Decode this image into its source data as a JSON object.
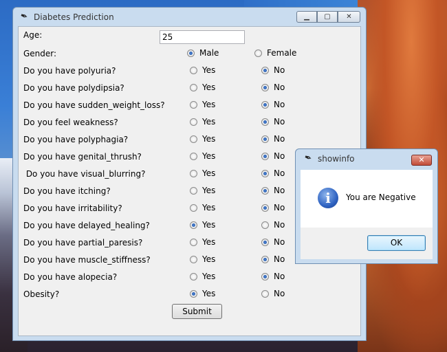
{
  "main_window": {
    "title": "Diabetes Prediction",
    "age": {
      "label": "Age:",
      "value": "25"
    },
    "gender": {
      "label": "Gender:",
      "options": [
        "Male",
        "Female"
      ],
      "selected": "Male"
    },
    "questions": [
      {
        "label": "Do you have polyuria?",
        "yes": "Yes",
        "no": "No",
        "selected": "No"
      },
      {
        "label": "Do you have polydipsia?",
        "yes": "Yes",
        "no": "No",
        "selected": "No"
      },
      {
        "label": "Do you have sudden_weight_loss?",
        "yes": "Yes",
        "no": "No",
        "selected": "No"
      },
      {
        "label": "Do you feel weakness?",
        "yes": "Yes",
        "no": "No",
        "selected": "No"
      },
      {
        "label": "Do you have polyphagia?",
        "yes": "Yes",
        "no": "No",
        "selected": "No"
      },
      {
        "label": "Do you have genital_thrush?",
        "yes": "Yes",
        "no": "No",
        "selected": "No"
      },
      {
        "label": " Do you have visual_blurring?",
        "yes": "Yes",
        "no": "No",
        "selected": "No"
      },
      {
        "label": "Do you have itching?",
        "yes": "Yes",
        "no": "No",
        "selected": "No"
      },
      {
        "label": "Do you have irritability?",
        "yes": "Yes",
        "no": "No",
        "selected": "No"
      },
      {
        "label": "Do you have delayed_healing?",
        "yes": "Yes",
        "no": "No",
        "selected": "Yes"
      },
      {
        "label": "Do you have partial_paresis?",
        "yes": "Yes",
        "no": "No",
        "selected": "No"
      },
      {
        "label": "Do you have muscle_stiffness?",
        "yes": "Yes",
        "no": "No",
        "selected": "No"
      },
      {
        "label": "Do you have alopecia?",
        "yes": "Yes",
        "no": "No",
        "selected": "No"
      },
      {
        "label": "Obesity?",
        "yes": "Yes",
        "no": "No",
        "selected": "Yes"
      }
    ],
    "submit_label": "Submit"
  },
  "dialog": {
    "title": "showinfo",
    "message": "You are Negative",
    "ok_label": "OK",
    "close_glyph": "✕",
    "icon": "info-icon"
  },
  "window_controls": {
    "minimize": "minimize-icon",
    "maximize": "maximize-icon",
    "close": "close-icon"
  }
}
